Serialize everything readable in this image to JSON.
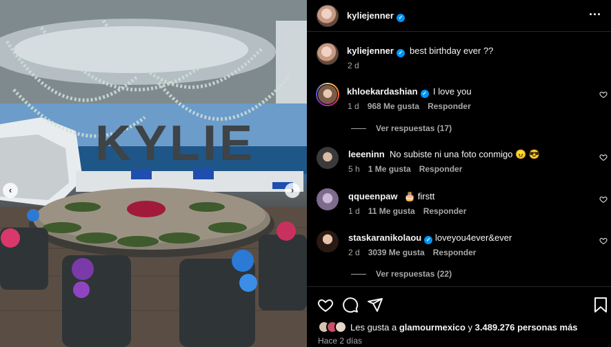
{
  "post": {
    "image_description_icon": "photo-icon",
    "image_balloon_text": "KYLIE",
    "nav": {
      "prev_icon": "chevron-left-icon",
      "next_icon": "chevron-right-icon"
    }
  },
  "header": {
    "username": "kyliejenner",
    "verified_icon": "verified-badge-icon",
    "more_icon": "more-options-icon"
  },
  "caption": {
    "username": "kyliejenner",
    "text": "best birthday ever ??",
    "time": "2 d"
  },
  "comments": [
    {
      "username": "khloekardashian",
      "verified": true,
      "text": "I love you",
      "time": "1 d",
      "likes": "968 Me gusta",
      "reply": "Responder",
      "replies": "Ver respuestas (17)"
    },
    {
      "username": "leeeninn",
      "verified": false,
      "text": "No subiste ni una foto conmigo 😠 😎",
      "time": "5 h",
      "likes": "1 Me gusta",
      "reply": "Responder"
    },
    {
      "username": "qqueenpaw",
      "verified": false,
      "text": "🎂 firstt",
      "time": "1 d",
      "likes": "11 Me gusta",
      "reply": "Responder"
    },
    {
      "username": "staskaranikolaou",
      "verified": true,
      "text": "loveyou4ever&ever",
      "time": "2 d",
      "likes": "3039 Me gusta",
      "reply": "Responder",
      "replies": "Ver respuestas (22)"
    }
  ],
  "actions": {
    "like_icon": "heart-icon",
    "comment_icon": "comment-icon",
    "share_icon": "send-icon",
    "save_icon": "bookmark-icon"
  },
  "likes": {
    "prefix": "Les gusta a ",
    "user": "glamourmexico",
    "middle": " y ",
    "count": "3.489.276 personas más"
  },
  "posted": "Hace 2 días",
  "colors": {
    "background": "#000000",
    "verified": "#0095f6",
    "secondary_text": "#a8a8a8",
    "divider": "#262626"
  }
}
